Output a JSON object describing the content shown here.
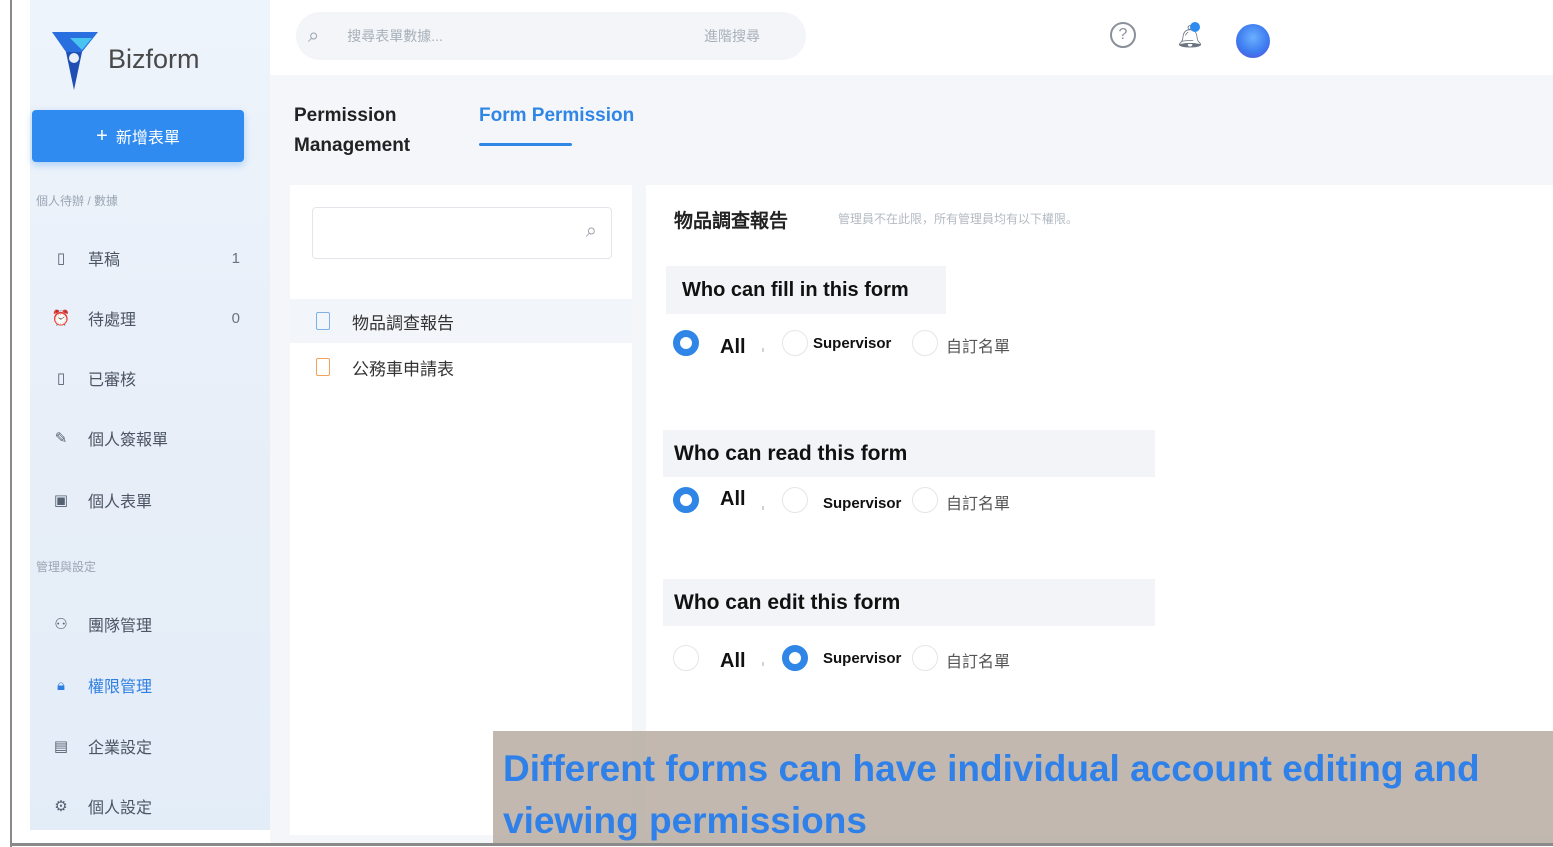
{
  "app": {
    "name": "Bizform"
  },
  "sidebar": {
    "new_button_label": "新增表單",
    "section_personal": "個人待辦 / 數據",
    "section_admin": "管理與設定",
    "items": [
      {
        "label": "草稿",
        "count": "1",
        "icon": "draft-doc-icon"
      },
      {
        "label": "待處理",
        "count": "0",
        "icon": "alarm-clock-icon"
      },
      {
        "label": "已審核",
        "count": "",
        "icon": "reviewed-doc-icon"
      },
      {
        "label": "個人簽報單",
        "count": "",
        "icon": "sign-doc-icon"
      },
      {
        "label": "個人表單",
        "count": "",
        "icon": "personal-form-icon"
      },
      {
        "label": "團隊管理",
        "count": "",
        "icon": "team-icon"
      },
      {
        "label": "權限管理",
        "count": "",
        "icon": "lock-icon",
        "active": true
      },
      {
        "label": "企業設定",
        "count": "",
        "icon": "building-icon"
      },
      {
        "label": "個人設定",
        "count": "",
        "icon": "settings-icon"
      }
    ]
  },
  "topbar": {
    "search_placeholder": "搜尋表單數據...",
    "advanced_search": "進階搜尋",
    "icons": [
      "help-icon",
      "bell-icon",
      "avatar"
    ]
  },
  "tabs": [
    {
      "label": "Permission Management"
    },
    {
      "label": "Form Permission",
      "active": true
    }
  ],
  "form_list": {
    "search_placeholder": "",
    "items": [
      {
        "label": "物品調查報告",
        "selected": true
      },
      {
        "label": "公務車申請表",
        "selected": false
      }
    ]
  },
  "permissions": {
    "form_title": "物品調查報告",
    "note": "管理員不在此限，所有管理員均有以下權限。",
    "groups": [
      {
        "question": "Who can fill in this form",
        "options": [
          "All",
          "Supervisor",
          "自訂名單"
        ],
        "selected": "All"
      },
      {
        "question": "Who can read this form",
        "options": [
          "All",
          "Supervisor",
          "自訂名單"
        ],
        "selected": "All"
      },
      {
        "question": "Who can edit this form",
        "options": [
          "All",
          "Supervisor",
          "自訂名單"
        ],
        "selected": "Supervisor"
      }
    ]
  },
  "caption": "Different forms can have individual account editing and viewing permissions",
  "colors": {
    "accent": "#2f86e6",
    "button": "#2f8bf0",
    "caption_bg": "#b4a89e"
  }
}
